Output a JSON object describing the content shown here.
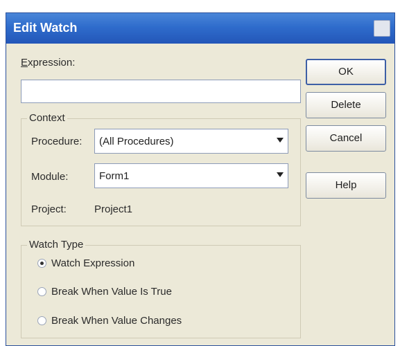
{
  "window": {
    "title": "Edit Watch"
  },
  "expression": {
    "label": "Expression:",
    "value": ""
  },
  "context": {
    "title": "Context",
    "procedure": {
      "label": "Procedure:",
      "value": "(All Procedures)"
    },
    "module": {
      "label": "Module:",
      "value": "Form1"
    },
    "project": {
      "label": "Project:",
      "value": "Project1"
    }
  },
  "watch_type": {
    "title": "Watch Type",
    "options": [
      {
        "label": "Watch Expression",
        "checked": true
      },
      {
        "label": "Break When Value Is True",
        "checked": false
      },
      {
        "label": "Break When Value Changes",
        "checked": false
      }
    ]
  },
  "buttons": {
    "ok": "OK",
    "delete": "Delete",
    "cancel": "Cancel",
    "help": "Help"
  }
}
